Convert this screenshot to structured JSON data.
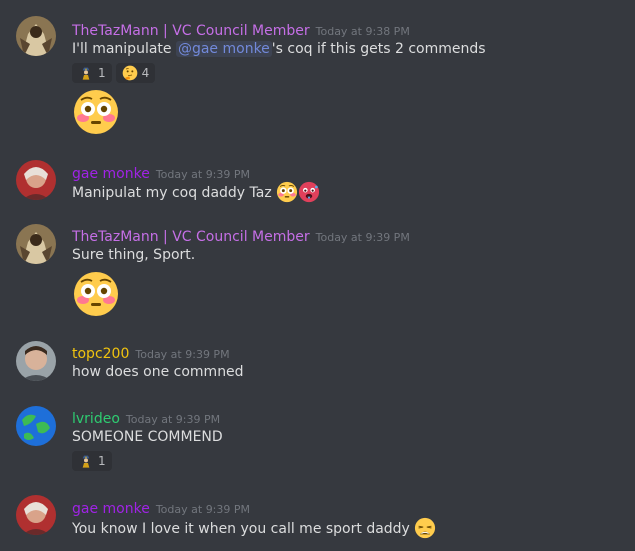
{
  "colors": {
    "background": "#36393f",
    "taz": "#c56fe6",
    "monke": "#a023e6",
    "topc": "#f1c40f",
    "lvrideo": "#2ecc71",
    "mention": "#7289da",
    "timestamp": "#72767d"
  },
  "messages": [
    {
      "author": "TheTazMann | VC Council Member",
      "timestamp": "Today at 9:38 PM",
      "text_before": "I'll manipulate ",
      "mention": "@gae monke",
      "text_after": "'s coq if this gets 2 commends",
      "reactions": [
        {
          "emoji": "guard-sticker-icon",
          "count": "1"
        },
        {
          "emoji": "thinking-face-icon",
          "count": "4"
        }
      ],
      "big_emoji": "flushed-face-icon"
    },
    {
      "author": "gae monke",
      "timestamp": "Today at 9:39 PM",
      "text": "Manipulat my coq daddy Taz",
      "inline_emojis": [
        "flushed-face-icon",
        "hot-face-icon"
      ]
    },
    {
      "author": "TheTazMann | VC Council Member",
      "timestamp": "Today at 9:39 PM",
      "text": "Sure thing, Sport.",
      "big_emoji": "flushed-face-icon"
    },
    {
      "author": "topc200",
      "timestamp": "Today at 9:39 PM",
      "text": "how does one commned"
    },
    {
      "author": "lvrideo",
      "timestamp": "Today at 9:39 PM",
      "text": "SOMEONE COMMEND",
      "reactions": [
        {
          "emoji": "guard-sticker-icon",
          "count": "1"
        }
      ]
    },
    {
      "author": "gae monke",
      "timestamp": "Today at 9:39 PM",
      "text": "You know I love it when you call me sport daddy",
      "inline_emojis": [
        "weary-face-icon"
      ]
    }
  ]
}
